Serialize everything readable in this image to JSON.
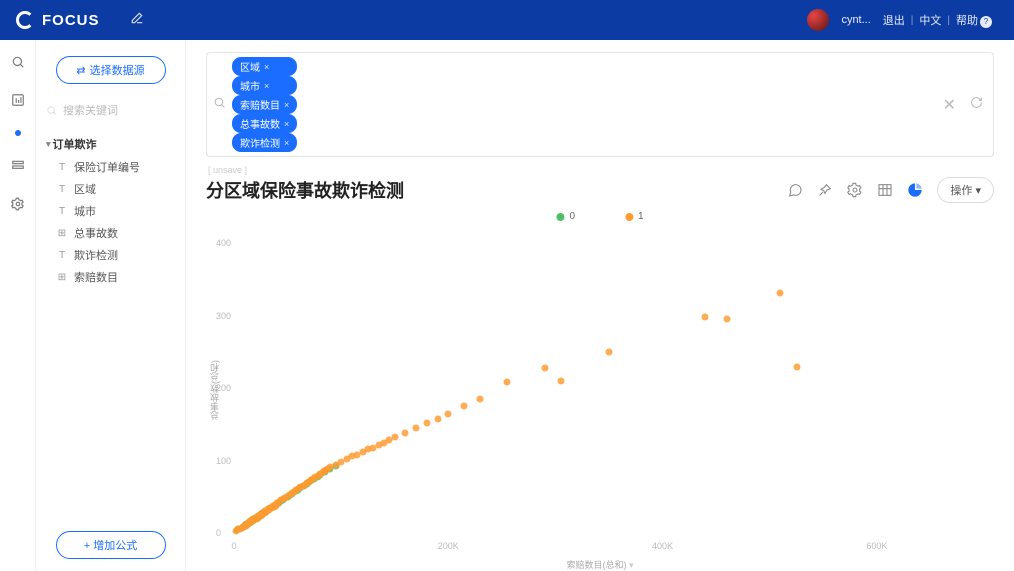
{
  "brand": "FOCUS",
  "top": {
    "user": "cynt...",
    "logout": "退出",
    "lang": "中文",
    "help": "帮助"
  },
  "side": {
    "select_ds": "选择数据源",
    "search_ph": "搜索关键词",
    "dataset": "订单欺诈",
    "fields": [
      {
        "icon": "text",
        "label": "保险订单编号"
      },
      {
        "icon": "text",
        "label": "区域"
      },
      {
        "icon": "text",
        "label": "城市"
      },
      {
        "icon": "num",
        "label": "总事故数"
      },
      {
        "icon": "text",
        "label": "欺诈检测"
      },
      {
        "icon": "num",
        "label": "索赔数目"
      }
    ],
    "add_formula": "+  增加公式"
  },
  "query": {
    "pills": [
      "区域",
      "城市",
      "索赔数目",
      "总事故数",
      "欺诈检测"
    ]
  },
  "crumb": "[ unsave ]",
  "title": "分区域保险事故欺诈检测",
  "op_btn": "操作",
  "chart_data": {
    "type": "scatter",
    "xlabel": "索赔数目(总和)",
    "ylabel": "总事故数(总和)",
    "xlim": [
      0,
      700000
    ],
    "ylim": [
      0,
      420
    ],
    "xticks": [
      0,
      200000,
      400000,
      600000
    ],
    "xticks_lbl": [
      "0",
      "200K",
      "400K",
      "600K"
    ],
    "yticks": [
      0,
      100,
      200,
      300,
      400
    ],
    "legend": [
      {
        "name": "0",
        "color": "#4fbf67"
      },
      {
        "name": "1",
        "color": "#ff9a2e"
      }
    ],
    "series": [
      {
        "name": "0",
        "color": "#4fbf67",
        "points": [
          [
            3000,
            4
          ],
          [
            5000,
            6
          ],
          [
            7000,
            7
          ],
          [
            8000,
            9
          ],
          [
            10000,
            10
          ],
          [
            11000,
            12
          ],
          [
            12000,
            11
          ],
          [
            13000,
            13
          ],
          [
            14000,
            15
          ],
          [
            15000,
            14
          ],
          [
            16000,
            16
          ],
          [
            17000,
            18
          ],
          [
            18000,
            17
          ],
          [
            19000,
            19
          ],
          [
            20000,
            20
          ],
          [
            21000,
            22
          ],
          [
            22000,
            21
          ],
          [
            23000,
            24
          ],
          [
            24000,
            23
          ],
          [
            25000,
            26
          ],
          [
            26000,
            25
          ],
          [
            27000,
            28
          ],
          [
            28000,
            27
          ],
          [
            29000,
            30
          ],
          [
            30000,
            29
          ],
          [
            32000,
            32
          ],
          [
            34000,
            34
          ],
          [
            36000,
            36
          ],
          [
            38000,
            38
          ],
          [
            40000,
            40
          ],
          [
            42000,
            42
          ],
          [
            44000,
            44
          ],
          [
            46000,
            46
          ],
          [
            48000,
            48
          ],
          [
            50000,
            50
          ],
          [
            52000,
            52
          ],
          [
            54000,
            54
          ],
          [
            56000,
            56
          ],
          [
            58000,
            58
          ],
          [
            60000,
            60
          ],
          [
            62000,
            62
          ],
          [
            65000,
            65
          ],
          [
            68000,
            68
          ],
          [
            70000,
            70
          ],
          [
            73000,
            73
          ],
          [
            75000,
            75
          ],
          [
            78000,
            78
          ],
          [
            80000,
            80
          ],
          [
            85000,
            84
          ],
          [
            90000,
            88
          ],
          [
            95000,
            92
          ]
        ]
      },
      {
        "name": "1",
        "color": "#ff9a2e",
        "points": [
          [
            2000,
            3
          ],
          [
            4000,
            5
          ],
          [
            6000,
            6
          ],
          [
            8000,
            8
          ],
          [
            9000,
            9
          ],
          [
            10000,
            11
          ],
          [
            11000,
            10
          ],
          [
            12000,
            13
          ],
          [
            13000,
            12
          ],
          [
            14000,
            14
          ],
          [
            15000,
            16
          ],
          [
            16000,
            15
          ],
          [
            17000,
            17
          ],
          [
            18000,
            19
          ],
          [
            19000,
            18
          ],
          [
            20000,
            21
          ],
          [
            21000,
            20
          ],
          [
            22000,
            23
          ],
          [
            23000,
            22
          ],
          [
            24000,
            25
          ],
          [
            25000,
            24
          ],
          [
            26000,
            27
          ],
          [
            27000,
            26
          ],
          [
            28000,
            29
          ],
          [
            29000,
            28
          ],
          [
            30000,
            31
          ],
          [
            31000,
            30
          ],
          [
            32000,
            33
          ],
          [
            33000,
            32
          ],
          [
            34000,
            35
          ],
          [
            35000,
            34
          ],
          [
            36000,
            37
          ],
          [
            37000,
            36
          ],
          [
            38000,
            39
          ],
          [
            39000,
            38
          ],
          [
            40000,
            41
          ],
          [
            42000,
            43
          ],
          [
            44000,
            45
          ],
          [
            46000,
            47
          ],
          [
            48000,
            49
          ],
          [
            50000,
            51
          ],
          [
            52000,
            53
          ],
          [
            54000,
            55
          ],
          [
            56000,
            57
          ],
          [
            58000,
            59
          ],
          [
            60000,
            61
          ],
          [
            62000,
            63
          ],
          [
            64000,
            65
          ],
          [
            66000,
            67
          ],
          [
            68000,
            69
          ],
          [
            70000,
            71
          ],
          [
            72000,
            73
          ],
          [
            74000,
            75
          ],
          [
            76000,
            77
          ],
          [
            78000,
            79
          ],
          [
            80000,
            81
          ],
          [
            82000,
            83
          ],
          [
            84000,
            85
          ],
          [
            86000,
            87
          ],
          [
            88000,
            89
          ],
          [
            90000,
            91
          ],
          [
            95000,
            94
          ],
          [
            100000,
            98
          ],
          [
            105000,
            102
          ],
          [
            110000,
            106
          ],
          [
            115000,
            108
          ],
          [
            120000,
            112
          ],
          [
            125000,
            116
          ],
          [
            130000,
            118
          ],
          [
            135000,
            122
          ],
          [
            140000,
            125
          ],
          [
            145000,
            128
          ],
          [
            150000,
            132
          ],
          [
            160000,
            138
          ],
          [
            170000,
            145
          ],
          [
            180000,
            152
          ],
          [
            190000,
            158
          ],
          [
            200000,
            165
          ],
          [
            215000,
            175
          ],
          [
            230000,
            185
          ],
          [
            255000,
            208
          ],
          [
            290000,
            228
          ],
          [
            305000,
            210
          ],
          [
            350000,
            250
          ],
          [
            440000,
            298
          ],
          [
            460000,
            295
          ],
          [
            510000,
            332
          ],
          [
            525000,
            230
          ]
        ]
      }
    ]
  }
}
